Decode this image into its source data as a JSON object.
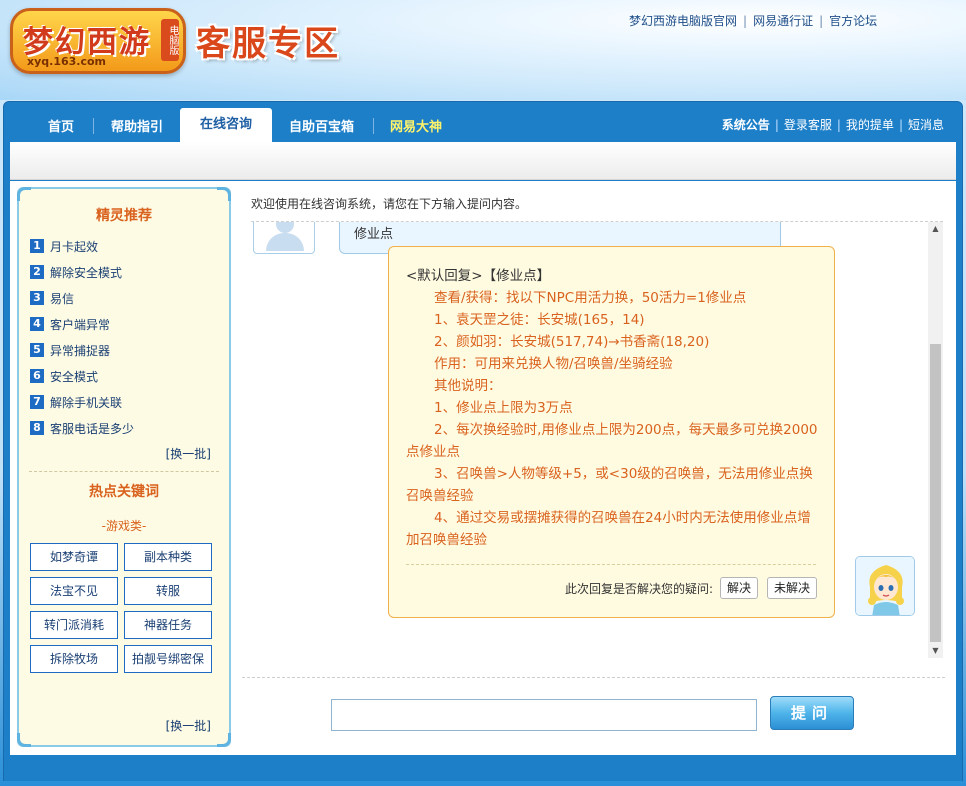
{
  "header": {
    "logo_text": "梦幻西游",
    "logo_sub": "xyq.163.com",
    "logo_badge": "电脑版",
    "title": "客服专区",
    "links": [
      "梦幻西游电脑版官网",
      "网易通行证",
      "官方论坛"
    ]
  },
  "nav": {
    "items": [
      "首页",
      "帮助指引",
      "在线咨询",
      "自助百宝箱",
      "网易大神"
    ],
    "active": "在线咨询",
    "right": [
      "系统公告",
      "登录客服",
      "我的提单",
      "短消息"
    ]
  },
  "sidebar": {
    "rec_title": "精灵推荐",
    "rec_items": [
      "月卡起效",
      "解除安全模式",
      "易信",
      "客户端异常",
      "异常捕捉器",
      "安全模式",
      "解除手机关联",
      "客服电话是多少"
    ],
    "rec_more": "[换一批]",
    "hot_title": "热点关键词",
    "hot_category": "-游戏类-",
    "keywords": [
      "如梦奇谭",
      "副本种类",
      "法宝不见",
      "转服",
      "转门派消耗",
      "神器任务",
      "拆除牧场",
      "拍靓号绑密保"
    ],
    "hot_more": "[换一批]"
  },
  "chat": {
    "welcome": "欢迎使用在线咨询系统，请您在下方输入提问内容。",
    "user_message": "修业点",
    "reply": {
      "heading": "<默认回复>【修业点】",
      "lines": [
        "查看/获得：找以下NPC用活力换，50活力=1修业点",
        "1、袁天罡之徒：长安城(165，14)",
        "2、颜如羽：长安城(517,74)→书香斋(18,20)",
        "作用：可用来兑换人物/召唤兽/坐骑经验",
        "其他说明：",
        "1、修业点上限为3万点",
        "2、每次换经验时,用修业点上限为200点，每天最多可兑换2000点修业点",
        "3、召唤兽>人物等级+5，或<30级的召唤兽，无法用修业点换召唤兽经验",
        "4、通过交易或摆摊获得的召唤兽在24小时内无法使用修业点增加召唤兽经验"
      ],
      "question": "此次回复是否解决您的疑问:",
      "resolved": "解决",
      "unresolved": "未解决"
    }
  },
  "input": {
    "placeholder": "",
    "submit": "提问"
  },
  "colors": {
    "nav_blue": "#1e7fc9",
    "accent_orange": "#d9621e",
    "link_blue": "#1a3f73"
  }
}
